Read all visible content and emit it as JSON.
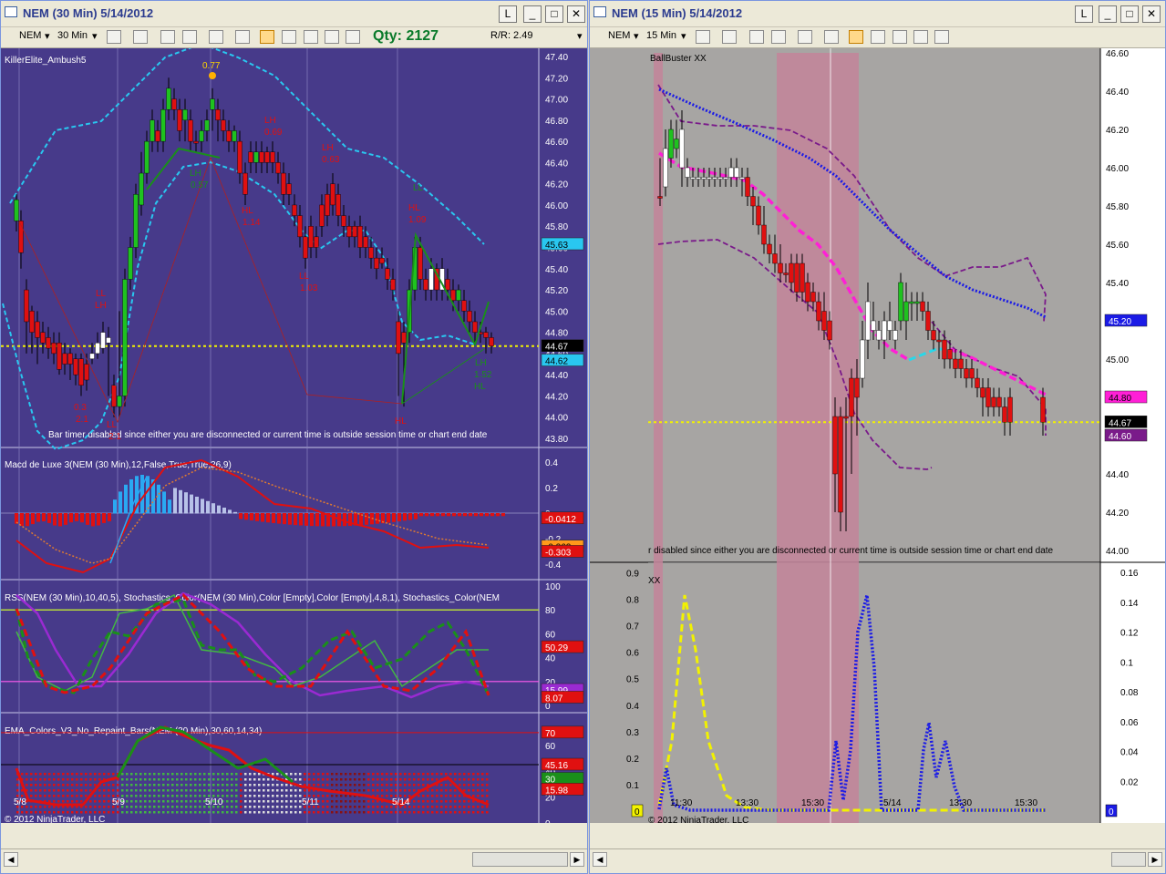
{
  "left": {
    "title": "NEM (30 Min)  5/14/2012",
    "instrument": "NEM",
    "interval": "30 Min",
    "qty": "Qty: 2127",
    "rr": "R/R: 2.49",
    "btn_l": "L",
    "price_panel_label": "KillerElite_Ambush5",
    "macd_label": "Macd de Luxe 3(NEM (30 Min),12,False,True,True,26,9)",
    "rss_label": "RSS(NEM (30 Min),10,40,5),  Stochastics_Color(NEM (30 Min),Color  [Empty],Color  [Empty],4,8,1),  Stochastics_Color(NEM",
    "ema_label": "EMA_Colors_V3_No_Repaint_Bars(NEM (30 Min),30,60,14,34)",
    "timer_msg": "Bar timer disabled since either you are disconnected or current time is outside session time or chart end date",
    "copyright": "© 2012 NinjaTrader, LLC",
    "price_ticks": [
      "47.40",
      "47.20",
      "47.00",
      "46.80",
      "46.60",
      "46.40",
      "46.20",
      "46.00",
      "45.80",
      "45.60",
      "45.40",
      "45.20",
      "45.00",
      "44.80",
      "44.60",
      "44.40",
      "44.20",
      "44.00",
      "43.80"
    ],
    "price_tags": [
      "45.63",
      "44.67",
      "44.62"
    ],
    "macd_ticks": [
      "0.4",
      "0.2",
      "0",
      "-0.2",
      "-0.4"
    ],
    "macd_tags": [
      "-0.0412",
      "-0.262",
      "-0.303"
    ],
    "rss_ticks": [
      "100",
      "80",
      "60",
      "40",
      "20",
      "0"
    ],
    "rss_tags": [
      "50.29",
      "15.99",
      "8.07"
    ],
    "ema_ticks": [
      "60",
      "40",
      "20",
      "0"
    ],
    "ema_tags": [
      "70",
      "45.16",
      "30",
      "15.98"
    ],
    "date_ticks": [
      "5/8",
      "5/9",
      "5/10",
      "5/11",
      "5/14"
    ],
    "annotations": [
      "0.77",
      "LH",
      "0.69",
      "LH",
      "0.63",
      "LH",
      "0.57",
      "HL",
      "1.14",
      "LL",
      "1.03",
      "LL",
      "LH",
      "0.3",
      "2.1",
      "LL",
      "2.1",
      "LL",
      "HL",
      "1.09",
      "HL",
      "LH",
      "1.52",
      "HL",
      "LL"
    ]
  },
  "right": {
    "title": "NEM (15 Min)  5/14/2012",
    "instrument": "NEM",
    "interval": "15 Min",
    "btn_l": "L",
    "price_panel_label": "BallBuster XX",
    "lower_label": "XX",
    "timer_msg": "r disabled since either you are disconnected or current time is outside session time or chart end date",
    "copyright": "© 2012 NinjaTrader, LLC",
    "price_ticks": [
      "46.60",
      "46.40",
      "46.20",
      "46.00",
      "45.80",
      "45.60",
      "45.40",
      "45.20",
      "45.00",
      "44.80",
      "44.60",
      "44.40",
      "44.20",
      "44.00"
    ],
    "price_tags": [
      "45.20",
      "44.80",
      "44.67",
      "44.60"
    ],
    "left_ticks": [
      "0.9",
      "0.8",
      "0.7",
      "0.6",
      "0.5",
      "0.4",
      "0.3",
      "0.2",
      "0.1"
    ],
    "right_ticks": [
      "0.16",
      "0.14",
      "0.12",
      "0.1",
      "0.08",
      "0.06",
      "0.04",
      "0.02"
    ],
    "zero_tags": [
      "0",
      "0"
    ],
    "time_ticks": [
      "11:30",
      "13:30",
      "15:30",
      "5/14",
      "13:30",
      "15:30"
    ]
  },
  "colors": {
    "left_bg": "#473a8a",
    "right_bg": "#a7a5a3",
    "bull": "#1fc21f",
    "bear": "#e01010",
    "band": "#29c7f0",
    "dotted_price": "#f2f200",
    "magenta": "#ff1fd6",
    "blue_dot": "#1b1be6",
    "session_pink": "#c3849a"
  }
}
